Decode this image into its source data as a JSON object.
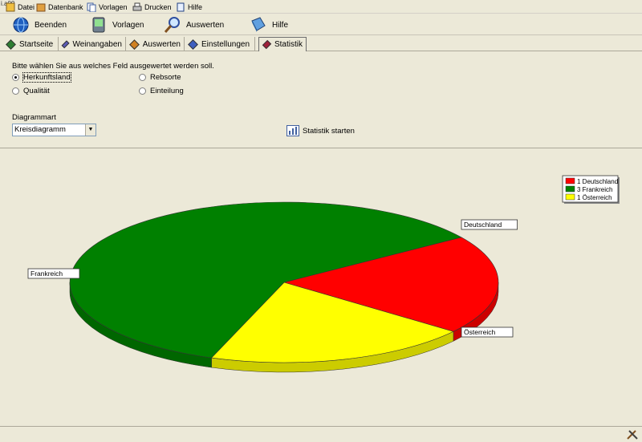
{
  "app": {
    "corner_text": "i.a00"
  },
  "menubar": {
    "items": [
      {
        "label": "Datei"
      },
      {
        "label": "Datenbank"
      },
      {
        "label": "Vorlagen"
      },
      {
        "label": "Drucken"
      },
      {
        "label": "Hilfe"
      }
    ]
  },
  "toolbar": {
    "items": [
      {
        "label": "Beenden",
        "icon": "globe-icon"
      },
      {
        "label": "Vorlagen",
        "icon": "handheld-icon"
      },
      {
        "label": "Auswerten",
        "icon": "magnifier-icon"
      },
      {
        "label": "Hilfe",
        "icon": "book-icon"
      }
    ]
  },
  "tabs": {
    "items": [
      {
        "label": "Startseite",
        "color": "#2e7d32"
      },
      {
        "label": "Weinangaben",
        "color": "#5c5cb8"
      },
      {
        "label": "Auswerten",
        "color": "#d08020"
      },
      {
        "label": "Einstellungen",
        "color": "#3f5fbf"
      },
      {
        "label": "Statistik",
        "color": "#a0203a"
      }
    ],
    "active": "Statistik"
  },
  "options": {
    "prompt": "Bitte wählen Sie aus welches Feld ausgewertet werden soll.",
    "radios": [
      {
        "label": "Herkunftsland",
        "checked": true
      },
      {
        "label": "Qualität",
        "checked": false
      },
      {
        "label": "Rebsorte",
        "checked": false
      },
      {
        "label": "Einteilung",
        "checked": false
      }
    ],
    "diagram_label": "Diagrammart",
    "diagram_value": "Kreisdiagramm",
    "start_label": "Statistik starten"
  },
  "chart_data": {
    "type": "pie",
    "categories": [
      "Deutschland",
      "Frankreich",
      "Österreich"
    ],
    "values": [
      1,
      3,
      1
    ],
    "colors": [
      "#ff0000",
      "#008000",
      "#ffff00"
    ],
    "legend": [
      "1 Deutschland",
      "3 Frankreich",
      "1 Österreich"
    ],
    "legend_position": "top-right",
    "style": "3d"
  }
}
